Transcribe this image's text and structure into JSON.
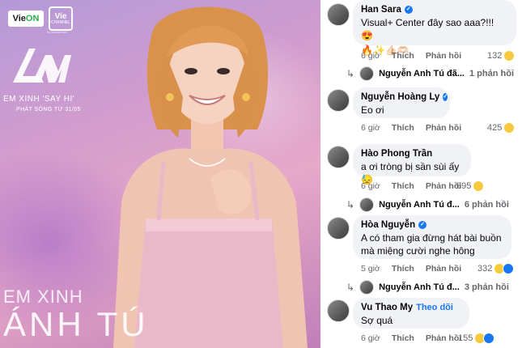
{
  "poster": {
    "logo_vieon_a": "Vie",
    "logo_vieon_b": "ON",
    "logo_vie": "Vie",
    "logo_vie_sub": "CHANNEL",
    "logo_subtitle": "by DatVietVAC",
    "show_title": "EM XINH 'SAY HI'",
    "show_date": "PHÁT SÓNG TỪ 31/05",
    "name_line1": "EM XINH",
    "name_line2": "ÁNH TÚ",
    "colors": {
      "accent_pink": "#e7a8c9",
      "accent_purple": "#b49ad8"
    }
  },
  "comments": [
    {
      "name": "Han Sara",
      "verified": true,
      "text": "Visual+ Center đây sao aaa?!!! 😍",
      "text2": "🔥✨👍🏻🫶🏻",
      "time": "6 giờ",
      "like": "Thích",
      "reply": "Phản hồi",
      "reaction_count": "132",
      "reply_summary": {
        "name": "Nguyễn Anh Tú đã...",
        "count": "1 phản hồi"
      }
    },
    {
      "name": "Nguyễn Hoàng Ly",
      "verified": true,
      "text": "Eo ơi",
      "time": "6 giờ",
      "like": "Thích",
      "reply": "Phản hồi",
      "reaction_count": "425"
    },
    {
      "name": "Hào Phong Trần",
      "verified": false,
      "text": "a ơi tròng bị sần sùi ấy 😓",
      "time": "6 giờ",
      "like": "Thích",
      "reply": "Phản hồi",
      "reaction_count": "695",
      "reply_summary": {
        "name": "Nguyễn Anh Tú đ...",
        "count": "6 phản hồi"
      }
    },
    {
      "name": "Hòa Nguyễn",
      "verified": true,
      "text": "A có tham gia đừng hát bài buồn mà miệng cười nghe hông",
      "time": "5 giờ",
      "like": "Thích",
      "reply": "Phản hồi",
      "reaction_count": "332",
      "reply_summary": {
        "name": "Nguyễn Anh Tú đ...",
        "count": "3 phản hồi"
      }
    },
    {
      "name": "Vu Thao My",
      "verified": false,
      "follow": "Theo dõi",
      "text": "Sợ quá",
      "time": "6 giờ",
      "like": "Thích",
      "reply": "Phản hồi",
      "reaction_count": "155"
    }
  ],
  "icons": {
    "verified": "verified-badge-icon",
    "reply_arrow": "reply-arrow-icon",
    "haha": "haha-reaction-icon",
    "like": "like-reaction-icon"
  }
}
